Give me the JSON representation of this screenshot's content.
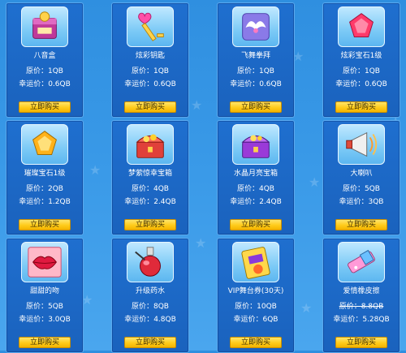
{
  "shop": {
    "items": [
      {
        "name": "八音盒",
        "original_price": "原价：1QB",
        "lucky_price": "幸运价：0.6QB",
        "buy_label": "立即购买",
        "icon": "music-box-icon"
      },
      {
        "name": "炫彩钥匙",
        "original_price": "原价：1QB",
        "lucky_price": "幸运价：0.6QB",
        "buy_label": "立即购买",
        "icon": "heart-key-icon"
      },
      {
        "name": "飞舞拳拜",
        "original_price": "原价：1QB",
        "lucky_price": "幸运价：0.6QB",
        "buy_label": "立即购买",
        "icon": "winged-card-icon"
      },
      {
        "name": "炫彩宝石1级",
        "original_price": "原价：1QB",
        "lucky_price": "幸运价：0.6QB",
        "buy_label": "立即购买",
        "icon": "red-gem-icon"
      },
      {
        "name": "璀璨宝石1级",
        "original_price": "原价：2QB",
        "lucky_price": "幸运价：1.2QB",
        "buy_label": "立即购买",
        "icon": "gold-gem-icon"
      },
      {
        "name": "梦萦惊幸宝箱",
        "original_price": "原价：4QB",
        "lucky_price": "幸运价：2.4QB",
        "buy_label": "立即购买",
        "icon": "red-treasure-chest-icon"
      },
      {
        "name": "水晶月亮宝箱",
        "original_price": "原价：4QB",
        "lucky_price": "幸运价：2.4QB",
        "buy_label": "立即购买",
        "icon": "purple-treasure-chest-icon"
      },
      {
        "name": "大喇叭",
        "original_price": "原价：5QB",
        "lucky_price": "幸运价：3QB",
        "buy_label": "立即购买",
        "icon": "megaphone-icon"
      },
      {
        "name": "甜甜的吻",
        "original_price": "原价：5QB",
        "lucky_price": "幸运价：3.0QB",
        "buy_label": "立即购买",
        "icon": "lips-icon"
      },
      {
        "name": "升级药水",
        "original_price": "原价：8QB",
        "lucky_price": "幸运价：4.8QB",
        "buy_label": "立即购买",
        "icon": "potion-icon"
      },
      {
        "name": "VIP舞台券(30天)",
        "original_price": "原价：10QB",
        "lucky_price": "幸运价：6QB",
        "buy_label": "立即购买",
        "icon": "vip-ticket-icon"
      },
      {
        "name": "爱情橡皮擦",
        "original_price": "原价：8.8QB",
        "lucky_price": "幸运价：5.28QB",
        "buy_label": "立即购买",
        "icon": "eraser-icon",
        "original_struck": true
      }
    ]
  }
}
